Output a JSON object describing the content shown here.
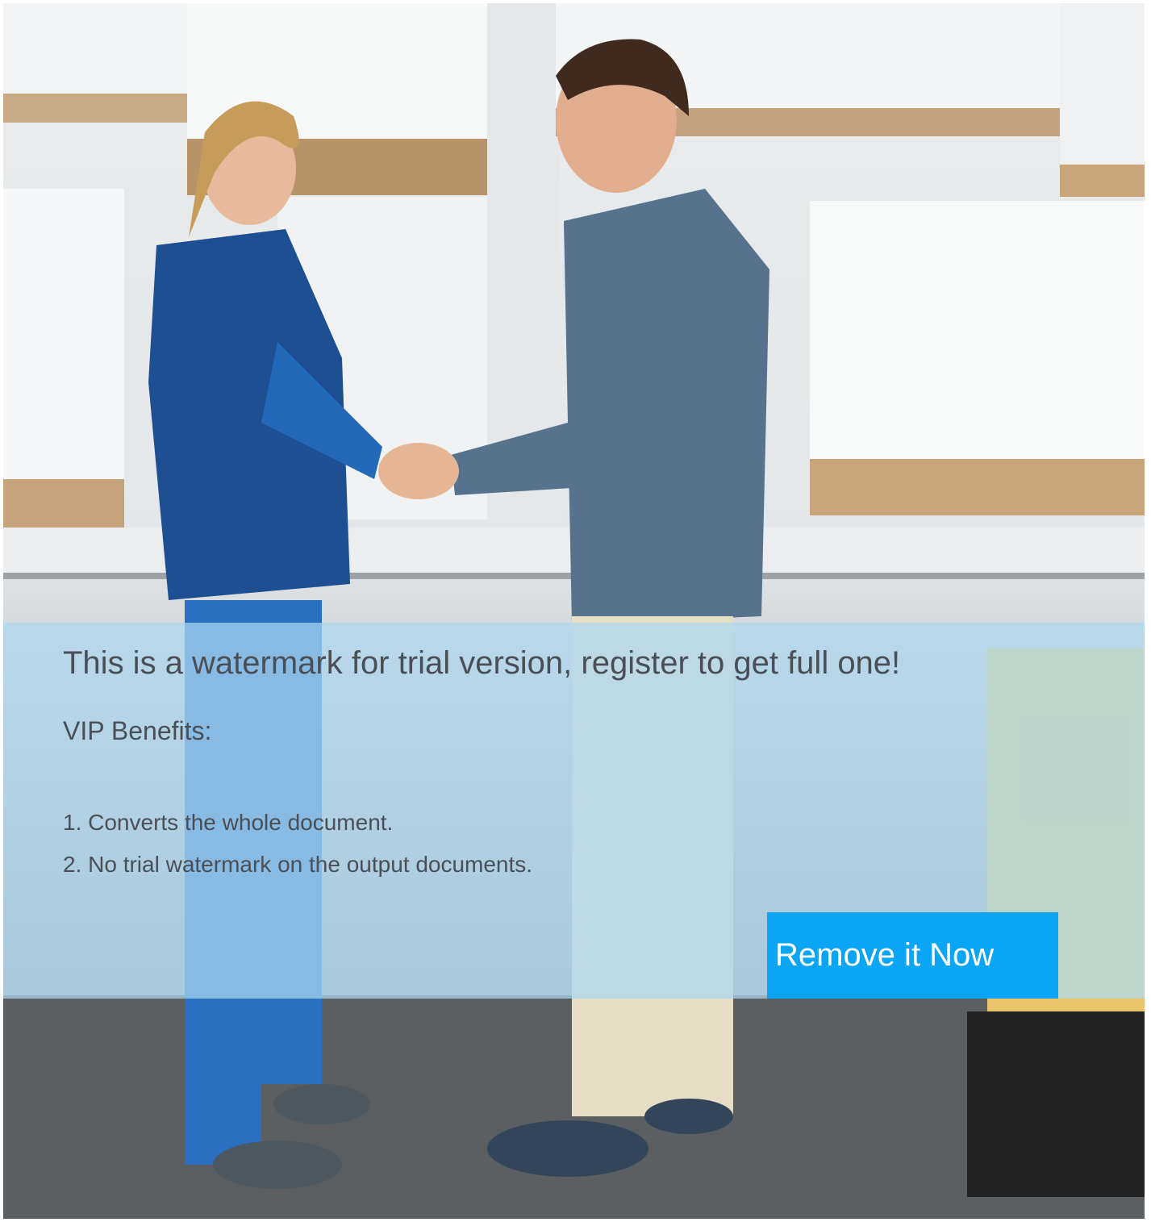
{
  "watermark": {
    "title": "This is a watermark for trial version, register to get full one!",
    "subtitle": "VIP Benefits:",
    "benefits": [
      "1. Converts the whole document.",
      "2. No trial watermark on the output documents."
    ],
    "button_label": "Remove it Now",
    "button_color": "#0aa5f5",
    "panel_color": "#add8f0"
  }
}
